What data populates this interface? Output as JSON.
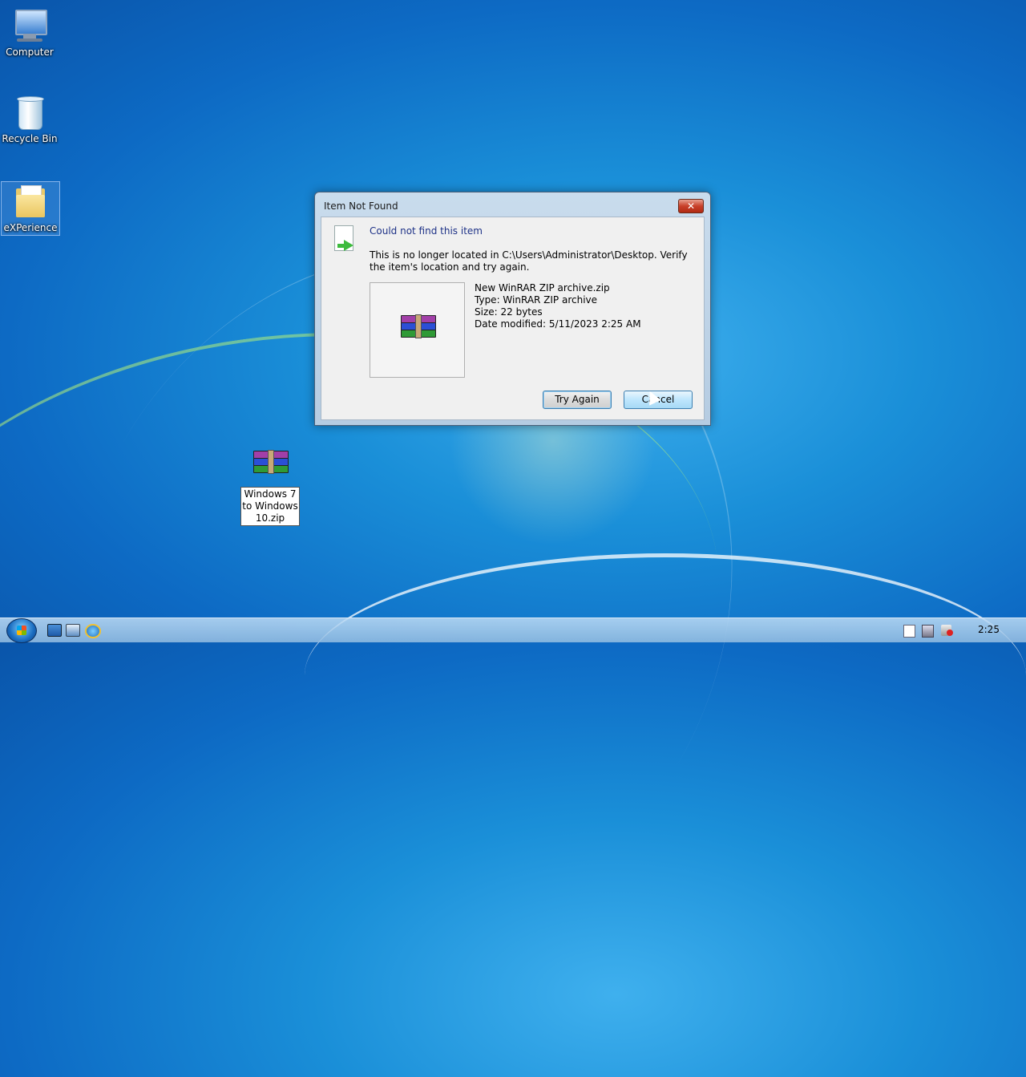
{
  "desktop": {
    "icons": [
      {
        "label": "Computer"
      },
      {
        "label": "Recycle Bin"
      },
      {
        "label": "eXPerience"
      }
    ],
    "dragged_file": {
      "label": "Windows 7 to Windows 10.zip",
      "lines": [
        "Windows 7",
        "to Windows",
        "10.zip"
      ]
    }
  },
  "dialog": {
    "title": "Item Not Found",
    "close_label": "✕",
    "heading": "Could not find this item",
    "message": "This is no longer located in C:\\Users\\Administrator\\Desktop. Verify the item's location and try again.",
    "file": {
      "name": "New WinRAR ZIP archive.zip",
      "type": "Type: WinRAR ZIP archive",
      "size": "Size: 22 bytes",
      "date": "Date modified: 5/11/2023 2:25 AM"
    },
    "buttons": {
      "try_again": "Try Again",
      "cancel": "Cancel"
    }
  },
  "taskbar": {
    "pinned": [
      "show-desktop-icon",
      "explorer-icon",
      "internet-explorer-icon"
    ],
    "tray": [
      "action-center-icon",
      "network-icon",
      "volume-muted-icon"
    ],
    "clock": "2:25"
  },
  "colors": {
    "heading": "#1e3287",
    "close_button": "#c8402a",
    "taskbar": "#a8cce8"
  }
}
